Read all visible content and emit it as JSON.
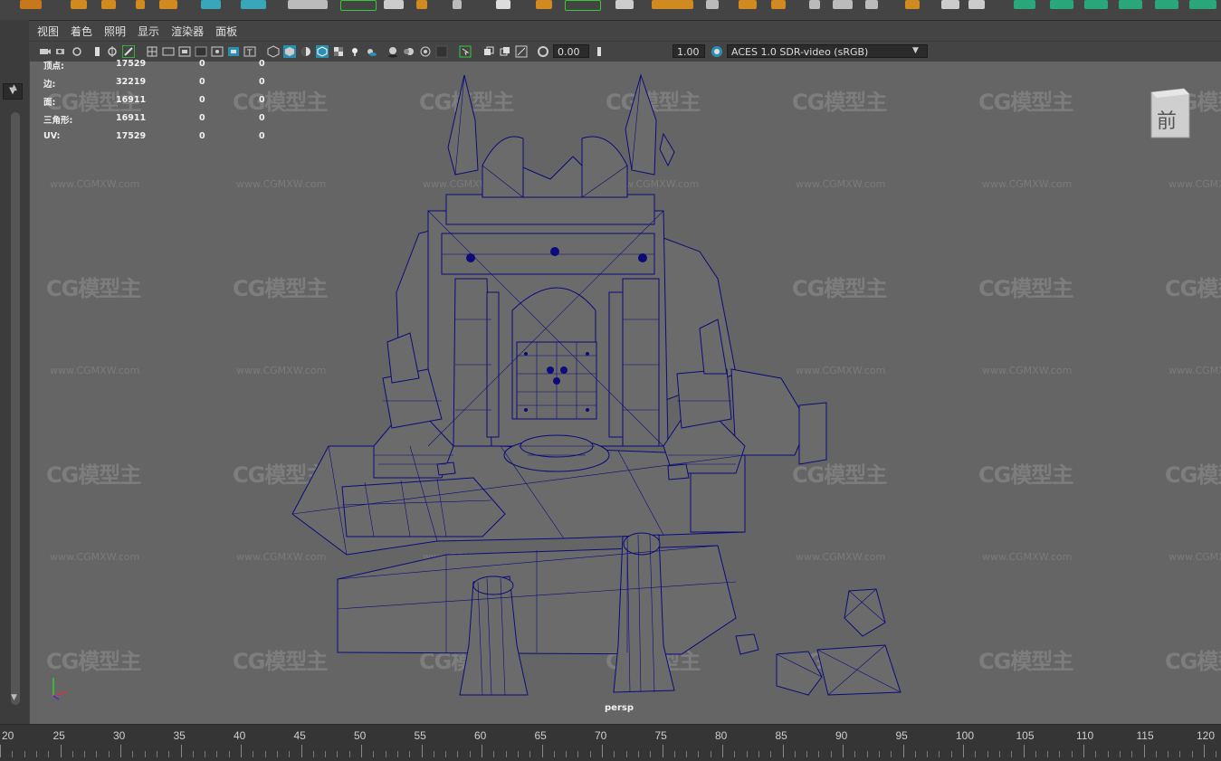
{
  "menus": [
    "视图",
    "着色",
    "照明",
    "显示",
    "渲染器",
    "面板"
  ],
  "stats": [
    {
      "label": "顶点:",
      "v1": "17529",
      "v2": "0",
      "v3": "0"
    },
    {
      "label": "边:",
      "v1": "32219",
      "v2": "0",
      "v3": "0"
    },
    {
      "label": "面:",
      "v1": "16911",
      "v2": "0",
      "v3": "0"
    },
    {
      "label": "三角形:",
      "v1": "16911",
      "v2": "0",
      "v3": "0"
    },
    {
      "label": "UV:",
      "v1": "17529",
      "v2": "0",
      "v3": "0"
    }
  ],
  "toolbar": {
    "exposure_value": "0.00",
    "gamma_value": "1.00",
    "color_space": "ACES 1.0 SDR-video (sRGB)"
  },
  "viewport": {
    "camera_label": "persp",
    "viewcube_label": "前",
    "background_color": "#656565",
    "wireframe_color": "#0b0b7a"
  },
  "watermark": {
    "logo_text": "CG模型主",
    "url_text": "www.CGMXW.com"
  },
  "timeline": {
    "ticks": [
      "20",
      "25",
      "30",
      "35",
      "40",
      "45",
      "50",
      "55",
      "60",
      "65",
      "70",
      "75",
      "80",
      "85",
      "90",
      "95",
      "100",
      "105",
      "110",
      "115",
      "120"
    ]
  },
  "icons": {
    "left_dropdown": "chevron-down-icon",
    "viewcube": "viewcube-icon",
    "axis": "axis-gizmo-icon"
  }
}
